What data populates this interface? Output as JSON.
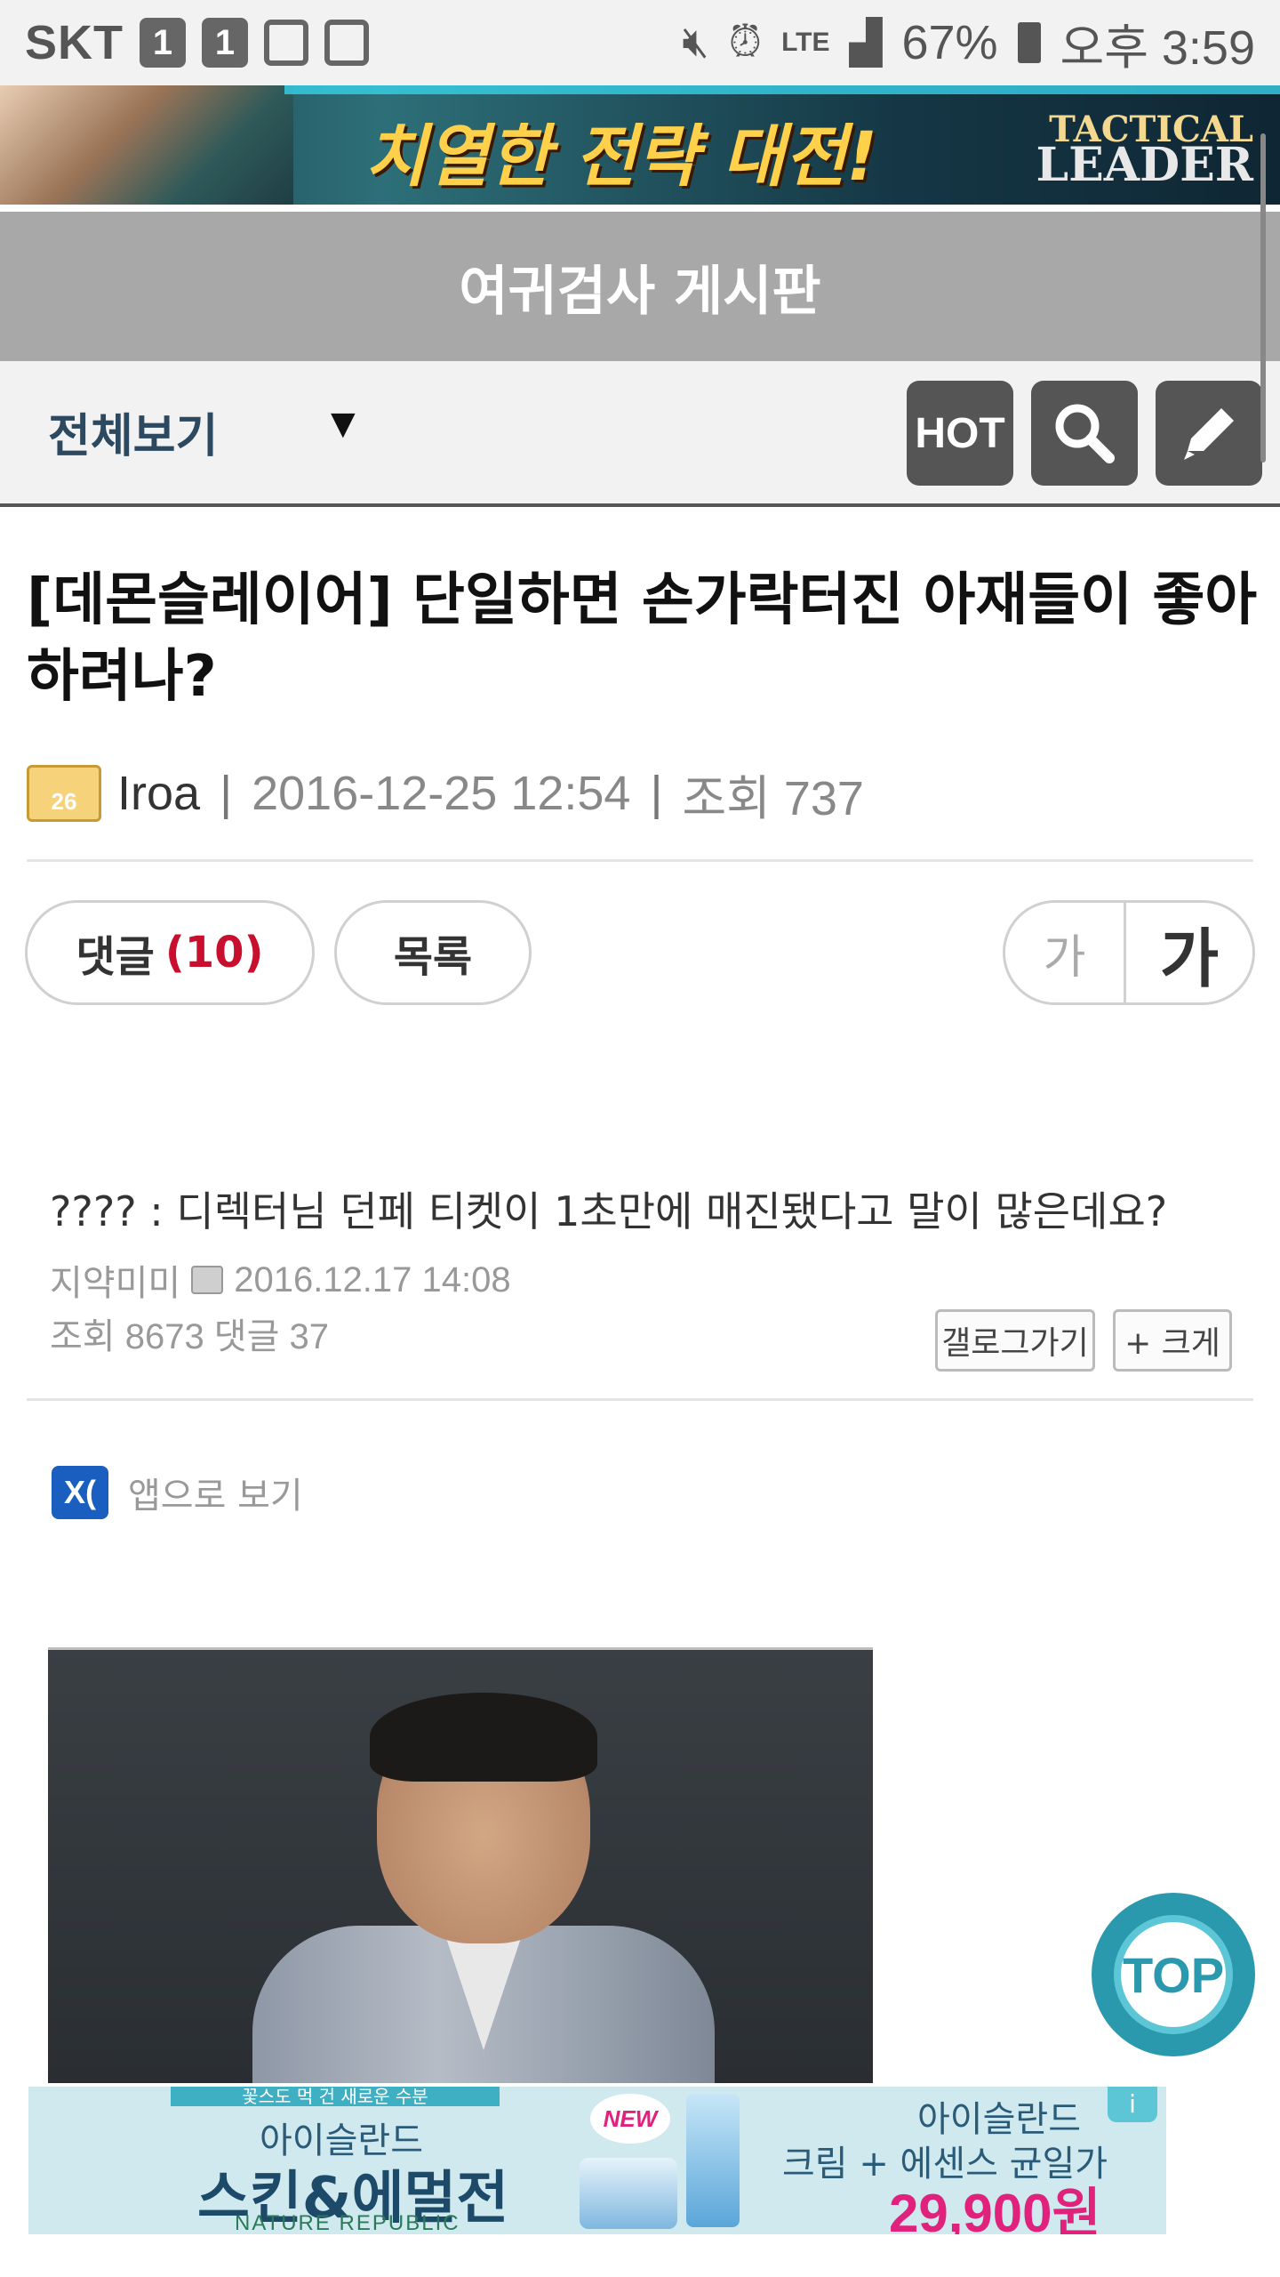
{
  "status_bar": {
    "carrier": "SKT",
    "notif_icon_1": "1",
    "notif_icon_2": "1",
    "battery": "67%",
    "time": "오후 3:59",
    "icons": [
      "mute-icon",
      "alarm-icon",
      "lte-icon",
      "signal-icon",
      "battery-icon"
    ]
  },
  "top_banner": {
    "headline": "치열한 전략 대전!",
    "brand_line1": "TACTICAL",
    "brand_line2": "LEADER"
  },
  "board": {
    "title": "여귀검사 게시판"
  },
  "toolbar": {
    "category": "전체보기",
    "caret": "▼",
    "hot_label": "HOT",
    "icons": [
      "search-icon",
      "pencil-icon"
    ]
  },
  "post": {
    "title": "[데몬슬레이어] 단일하면 손가락터진 아재들이 좋아하려나?",
    "level_badge": "26",
    "author": "Iroa",
    "date": "2016-12-25 12:54",
    "views": "조회 737"
  },
  "actions": {
    "comments_label": "댓글",
    "comments_count": "(10)",
    "list_label": "목록",
    "font_small": "가",
    "font_large": "가"
  },
  "embed": {
    "question": "???? : 디렉터님 던페 티켓이 1초만에 매진됐다고 말이 많은데요?",
    "author": "지약미미",
    "date": "2016.12.17 14:08",
    "stats": "조회 8673 댓글 37",
    "gallery_button": "갤로그가기",
    "bigger_button": "+ 크게",
    "app_logo": "X(",
    "app_text": "앱으로 보기"
  },
  "top_button": "TOP",
  "bottom_ad": {
    "ribbon": "꽃스도 먹 건 새로운 수분",
    "line1": "아이슬란드",
    "line2": "스킨&에멀전",
    "line3": "NATURE REPUBLIC",
    "new_tag": "NEW",
    "right1": "아이슬란드",
    "right2": "크림 + 에센스 균일가",
    "price": "29,900원",
    "badge": "i"
  }
}
